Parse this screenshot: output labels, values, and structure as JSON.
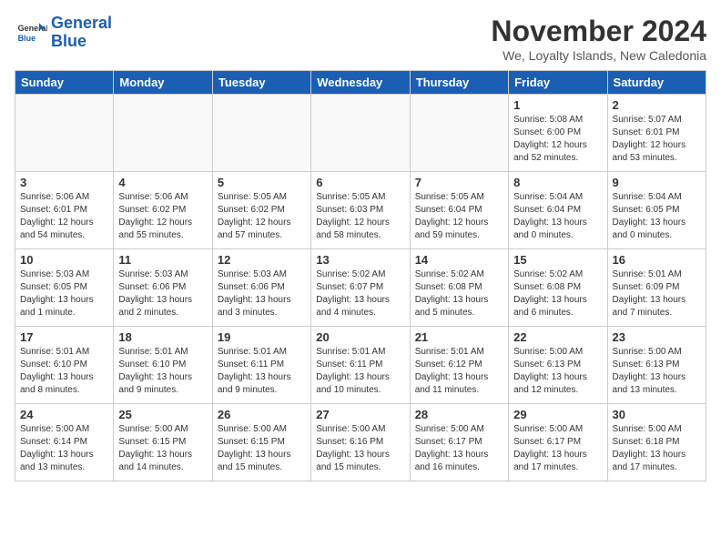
{
  "logo": {
    "line1": "General",
    "line2": "Blue"
  },
  "title": "November 2024",
  "subtitle": "We, Loyalty Islands, New Caledonia",
  "days_of_week": [
    "Sunday",
    "Monday",
    "Tuesday",
    "Wednesday",
    "Thursday",
    "Friday",
    "Saturday"
  ],
  "weeks": [
    [
      {
        "day": "",
        "info": ""
      },
      {
        "day": "",
        "info": ""
      },
      {
        "day": "",
        "info": ""
      },
      {
        "day": "",
        "info": ""
      },
      {
        "day": "",
        "info": ""
      },
      {
        "day": "1",
        "info": "Sunrise: 5:08 AM\nSunset: 6:00 PM\nDaylight: 12 hours\nand 52 minutes."
      },
      {
        "day": "2",
        "info": "Sunrise: 5:07 AM\nSunset: 6:01 PM\nDaylight: 12 hours\nand 53 minutes."
      }
    ],
    [
      {
        "day": "3",
        "info": "Sunrise: 5:06 AM\nSunset: 6:01 PM\nDaylight: 12 hours\nand 54 minutes."
      },
      {
        "day": "4",
        "info": "Sunrise: 5:06 AM\nSunset: 6:02 PM\nDaylight: 12 hours\nand 55 minutes."
      },
      {
        "day": "5",
        "info": "Sunrise: 5:05 AM\nSunset: 6:02 PM\nDaylight: 12 hours\nand 57 minutes."
      },
      {
        "day": "6",
        "info": "Sunrise: 5:05 AM\nSunset: 6:03 PM\nDaylight: 12 hours\nand 58 minutes."
      },
      {
        "day": "7",
        "info": "Sunrise: 5:05 AM\nSunset: 6:04 PM\nDaylight: 12 hours\nand 59 minutes."
      },
      {
        "day": "8",
        "info": "Sunrise: 5:04 AM\nSunset: 6:04 PM\nDaylight: 13 hours\nand 0 minutes."
      },
      {
        "day": "9",
        "info": "Sunrise: 5:04 AM\nSunset: 6:05 PM\nDaylight: 13 hours\nand 0 minutes."
      }
    ],
    [
      {
        "day": "10",
        "info": "Sunrise: 5:03 AM\nSunset: 6:05 PM\nDaylight: 13 hours\nand 1 minute."
      },
      {
        "day": "11",
        "info": "Sunrise: 5:03 AM\nSunset: 6:06 PM\nDaylight: 13 hours\nand 2 minutes."
      },
      {
        "day": "12",
        "info": "Sunrise: 5:03 AM\nSunset: 6:06 PM\nDaylight: 13 hours\nand 3 minutes."
      },
      {
        "day": "13",
        "info": "Sunrise: 5:02 AM\nSunset: 6:07 PM\nDaylight: 13 hours\nand 4 minutes."
      },
      {
        "day": "14",
        "info": "Sunrise: 5:02 AM\nSunset: 6:08 PM\nDaylight: 13 hours\nand 5 minutes."
      },
      {
        "day": "15",
        "info": "Sunrise: 5:02 AM\nSunset: 6:08 PM\nDaylight: 13 hours\nand 6 minutes."
      },
      {
        "day": "16",
        "info": "Sunrise: 5:01 AM\nSunset: 6:09 PM\nDaylight: 13 hours\nand 7 minutes."
      }
    ],
    [
      {
        "day": "17",
        "info": "Sunrise: 5:01 AM\nSunset: 6:10 PM\nDaylight: 13 hours\nand 8 minutes."
      },
      {
        "day": "18",
        "info": "Sunrise: 5:01 AM\nSunset: 6:10 PM\nDaylight: 13 hours\nand 9 minutes."
      },
      {
        "day": "19",
        "info": "Sunrise: 5:01 AM\nSunset: 6:11 PM\nDaylight: 13 hours\nand 9 minutes."
      },
      {
        "day": "20",
        "info": "Sunrise: 5:01 AM\nSunset: 6:11 PM\nDaylight: 13 hours\nand 10 minutes."
      },
      {
        "day": "21",
        "info": "Sunrise: 5:01 AM\nSunset: 6:12 PM\nDaylight: 13 hours\nand 11 minutes."
      },
      {
        "day": "22",
        "info": "Sunrise: 5:00 AM\nSunset: 6:13 PM\nDaylight: 13 hours\nand 12 minutes."
      },
      {
        "day": "23",
        "info": "Sunrise: 5:00 AM\nSunset: 6:13 PM\nDaylight: 13 hours\nand 13 minutes."
      }
    ],
    [
      {
        "day": "24",
        "info": "Sunrise: 5:00 AM\nSunset: 6:14 PM\nDaylight: 13 hours\nand 13 minutes."
      },
      {
        "day": "25",
        "info": "Sunrise: 5:00 AM\nSunset: 6:15 PM\nDaylight: 13 hours\nand 14 minutes."
      },
      {
        "day": "26",
        "info": "Sunrise: 5:00 AM\nSunset: 6:15 PM\nDaylight: 13 hours\nand 15 minutes."
      },
      {
        "day": "27",
        "info": "Sunrise: 5:00 AM\nSunset: 6:16 PM\nDaylight: 13 hours\nand 15 minutes."
      },
      {
        "day": "28",
        "info": "Sunrise: 5:00 AM\nSunset: 6:17 PM\nDaylight: 13 hours\nand 16 minutes."
      },
      {
        "day": "29",
        "info": "Sunrise: 5:00 AM\nSunset: 6:17 PM\nDaylight: 13 hours\nand 17 minutes."
      },
      {
        "day": "30",
        "info": "Sunrise: 5:00 AM\nSunset: 6:18 PM\nDaylight: 13 hours\nand 17 minutes."
      }
    ]
  ]
}
